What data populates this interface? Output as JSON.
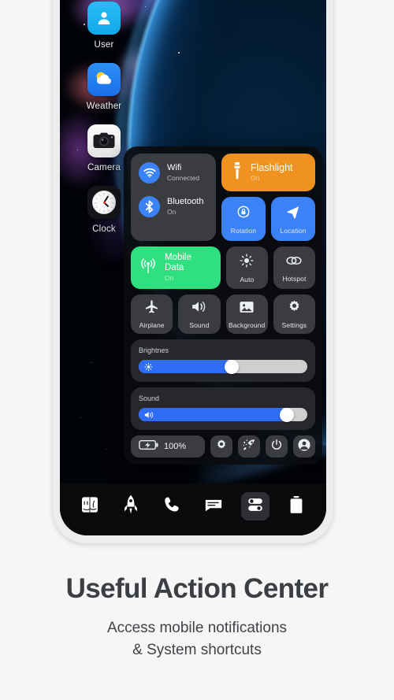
{
  "wallpaper": {
    "theme": "space-planet-nebula"
  },
  "home_apps": [
    {
      "label": "User",
      "icon": "contact-icon"
    },
    {
      "label": "Weather",
      "icon": "sun-cloud-icon"
    },
    {
      "label": "Camera",
      "icon": "camera-icon"
    },
    {
      "label": "Clock",
      "icon": "analog-clock-icon"
    }
  ],
  "control_center": {
    "connectivity": [
      {
        "title": "Wifi",
        "status": "Connected",
        "icon": "wifi-icon",
        "accent": "#3b82f6"
      },
      {
        "title": "Bluetooth",
        "status": "On",
        "icon": "bluetooth-icon",
        "accent": "#3b82f6"
      }
    ],
    "flashlight": {
      "title": "Flashlight",
      "status": "On",
      "icon": "flashlight-icon",
      "color": "#ef9220"
    },
    "rotation": {
      "label": "Rotation",
      "icon": "rotation-lock-icon",
      "color": "#3b82f6"
    },
    "location": {
      "label": "Location",
      "icon": "location-arrow-icon",
      "color": "#3b82f6"
    },
    "mobile_data": {
      "title": "Mobile Data",
      "status": "On",
      "icon": "signal-tower-icon",
      "color": "#2ee07e"
    },
    "auto": {
      "label": "Auto",
      "icon": "brightness-auto-icon"
    },
    "hotspot": {
      "label": "Hotspot",
      "icon": "hotspot-link-icon"
    },
    "row4": [
      {
        "label": "Airplane",
        "icon": "airplane-icon"
      },
      {
        "label": "Sound",
        "icon": "speaker-icon"
      },
      {
        "label": "Background",
        "icon": "wallpaper-image-icon"
      },
      {
        "label": "Settings",
        "icon": "gear-icon"
      }
    ],
    "sliders": [
      {
        "label": "Brightnes",
        "icon": "brightness-icon",
        "value": 55
      },
      {
        "label": "Sound",
        "icon": "volume-icon",
        "value": 88
      }
    ],
    "bottom_actions": {
      "battery": {
        "label": "100%",
        "icon": "battery-charging-icon"
      },
      "items": [
        {
          "icon": "gear-icon",
          "name": "settings"
        },
        {
          "icon": "rocket-boost-icon",
          "name": "cleaner"
        },
        {
          "icon": "power-icon",
          "name": "power"
        },
        {
          "icon": "user-circle-icon",
          "name": "profile"
        }
      ]
    }
  },
  "dock": [
    {
      "icon": "finder-icon",
      "name": "finder",
      "active": false
    },
    {
      "icon": "rocket-icon",
      "name": "launchpad",
      "active": false
    },
    {
      "icon": "phone-icon",
      "name": "phone",
      "active": false
    },
    {
      "icon": "message-icon",
      "name": "messages",
      "active": false
    },
    {
      "icon": "toggles-icon",
      "name": "control-center",
      "active": true
    },
    {
      "icon": "trash-icon",
      "name": "trash",
      "active": false
    }
  ],
  "caption": {
    "headline": "Useful Action Center",
    "subline_1": "Access mobile notifications",
    "subline_2": "& System shortcuts"
  }
}
